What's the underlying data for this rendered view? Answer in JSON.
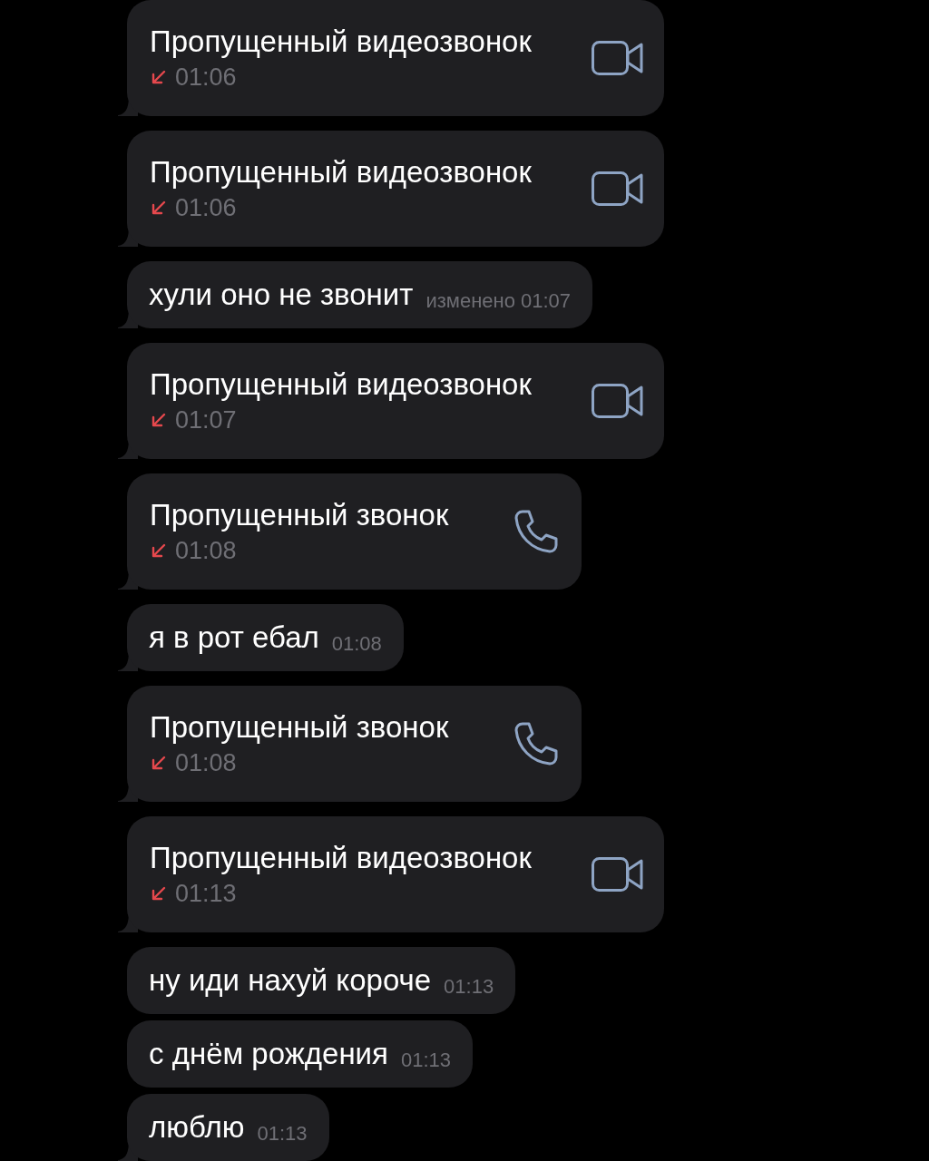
{
  "messages": [
    {
      "kind": "video_call",
      "title": "Пропущенный видеозвонок",
      "missed": true,
      "time": "01:06",
      "tail": true
    },
    {
      "kind": "video_call",
      "title": "Пропущенный видеозвонок",
      "missed": true,
      "time": "01:06",
      "tail": true
    },
    {
      "kind": "text",
      "text": "хули оно не звонит",
      "edited_label": "изменено",
      "time": "01:07",
      "tail": true
    },
    {
      "kind": "video_call",
      "title": "Пропущенный видеозвонок",
      "missed": true,
      "time": "01:07",
      "tail": true
    },
    {
      "kind": "voice_call",
      "title": "Пропущенный звонок",
      "missed": true,
      "time": "01:08",
      "tail": true
    },
    {
      "kind": "text",
      "text": "я в рот ебал",
      "time": "01:08",
      "tail": true
    },
    {
      "kind": "voice_call",
      "title": "Пропущенный звонок",
      "missed": true,
      "time": "01:08",
      "tail": true
    },
    {
      "kind": "video_call",
      "title": "Пропущенный видеозвонок",
      "missed": true,
      "time": "01:13",
      "tail": true
    },
    {
      "kind": "text",
      "text": "ну иди нахуй короче",
      "time": "01:13",
      "tail": false
    },
    {
      "kind": "text",
      "text": "с днём рождения",
      "time": "01:13",
      "tail": false
    },
    {
      "kind": "text",
      "text": "люблю",
      "time": "01:13",
      "tail": true
    }
  ]
}
